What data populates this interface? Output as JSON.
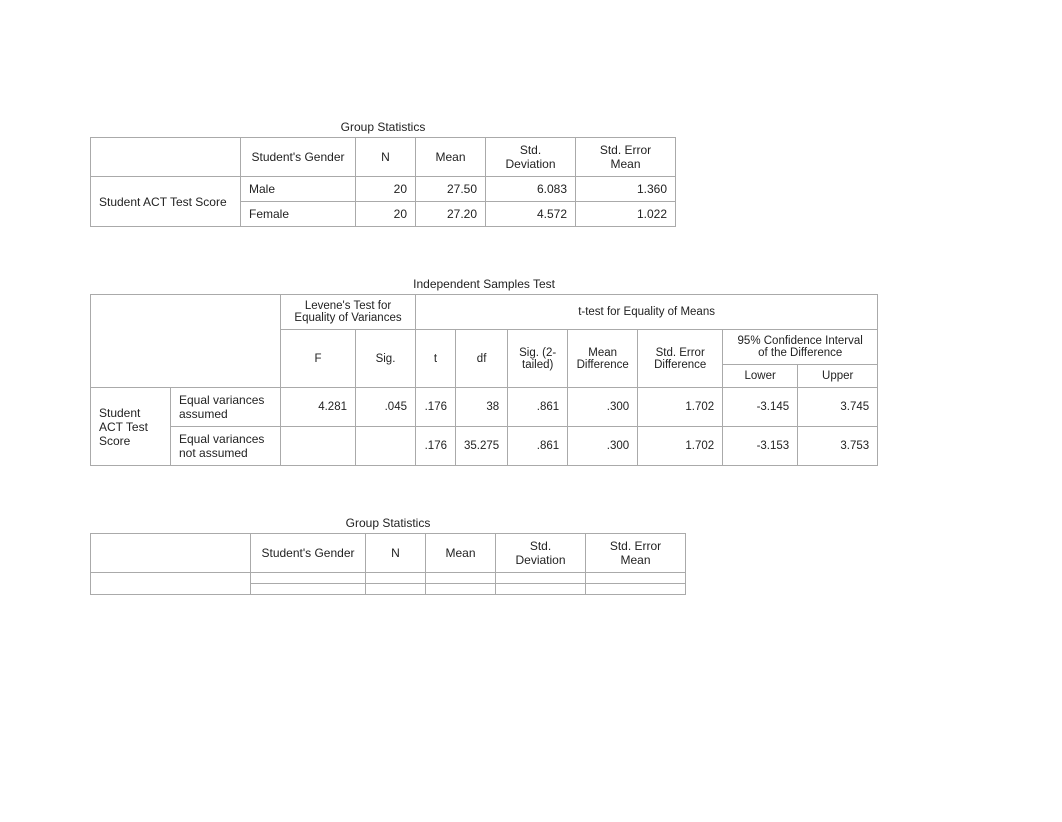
{
  "group_stats_1": {
    "title": "Group Statistics",
    "headers": {
      "rowhead": "",
      "gender": "Student's Gender",
      "n": "N",
      "mean": "Mean",
      "sd": "Std. Deviation",
      "sem": "Std. Error Mean"
    },
    "row_label": "Student ACT Test Score",
    "rows": [
      {
        "gender": "Male",
        "n": "20",
        "mean": "27.50",
        "sd": "6.083",
        "sem": "1.360"
      },
      {
        "gender": "Female",
        "n": "20",
        "mean": "27.20",
        "sd": "4.572",
        "sem": "1.022"
      }
    ]
  },
  "indep_samples": {
    "title": "Independent Samples Test",
    "headers": {
      "levene": "Levene's Test for Equality of Variances",
      "ttest": "t-test for Equality of Means",
      "f": "F",
      "sig": "Sig.",
      "t": "t",
      "df": "df",
      "sig2": "Sig. (2-tailed)",
      "mdiff": "Mean Difference",
      "sediff": "Std. Error Difference",
      "ci": "95% Confidence Interval of the Difference",
      "lower": "Lower",
      "upper": "Upper"
    },
    "row_label": "Student ACT Test Score",
    "rows": [
      {
        "assume": "Equal variances assumed",
        "f": "4.281",
        "sig": ".045",
        "t": ".176",
        "df": "38",
        "sig2": ".861",
        "mdiff": ".300",
        "sediff": "1.702",
        "lower": "-3.145",
        "upper": "3.745"
      },
      {
        "assume": "Equal variances not assumed",
        "f": "",
        "sig": "",
        "t": ".176",
        "df": "35.275",
        "sig2": ".861",
        "mdiff": ".300",
        "sediff": "1.702",
        "lower": "-3.153",
        "upper": "3.753"
      }
    ]
  },
  "group_stats_2": {
    "title": "Group Statistics",
    "headers": {
      "rowhead": "",
      "gender": "Student's Gender",
      "n": "N",
      "mean": "Mean",
      "sd": "Std. Deviation",
      "sem": "Std. Error Mean"
    },
    "row_label": " ",
    "rows": [
      {
        "gender": " ",
        "n": " ",
        "mean": " ",
        "sd": " ",
        "sem": " "
      },
      {
        "gender": " ",
        "n": " ",
        "mean": " ",
        "sd": " ",
        "sem": " "
      }
    ]
  },
  "chart_data": [
    {
      "type": "table",
      "title": "Group Statistics",
      "columns": [
        "Student's Gender",
        "N",
        "Mean",
        "Std. Deviation",
        "Std. Error Mean"
      ],
      "row_label": "Student ACT Test Score",
      "rows": [
        [
          "Male",
          20,
          27.5,
          6.083,
          1.36
        ],
        [
          "Female",
          20,
          27.2,
          4.572,
          1.022
        ]
      ]
    },
    {
      "type": "table",
      "title": "Independent Samples Test",
      "row_label": "Student ACT Test Score",
      "columns": [
        "",
        "F",
        "Sig.",
        "t",
        "df",
        "Sig. (2-tailed)",
        "Mean Difference",
        "Std. Error Difference",
        "95% CI Lower",
        "95% CI Upper"
      ],
      "rows": [
        [
          "Equal variances assumed",
          4.281,
          0.045,
          0.176,
          38,
          0.861,
          0.3,
          1.702,
          -3.145,
          3.745
        ],
        [
          "Equal variances not assumed",
          null,
          null,
          0.176,
          35.275,
          0.861,
          0.3,
          1.702,
          -3.153,
          3.753
        ]
      ]
    }
  ]
}
